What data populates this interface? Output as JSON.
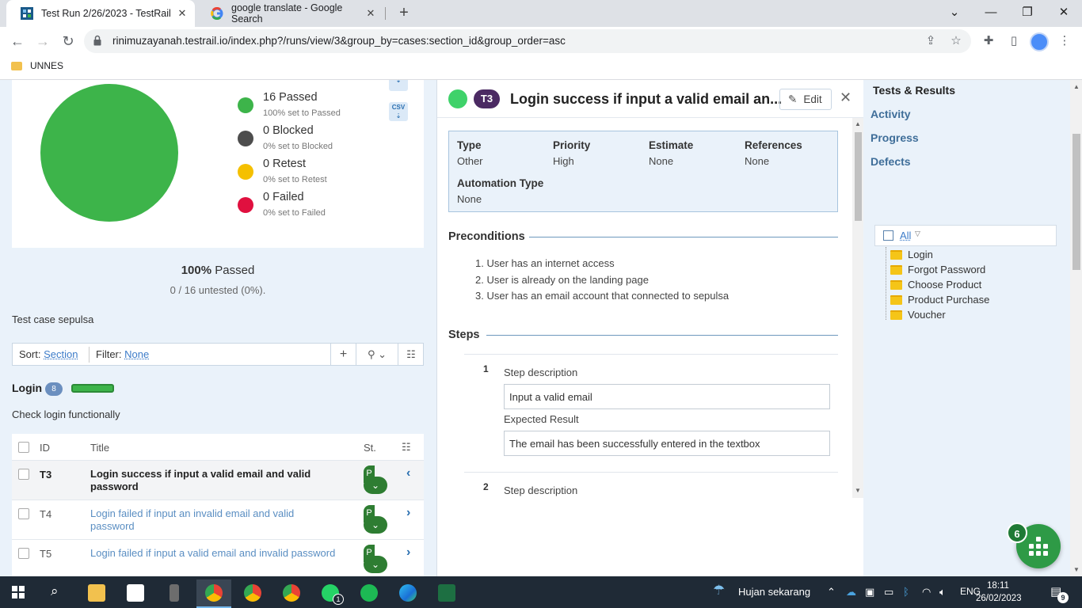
{
  "browser": {
    "tabs": [
      {
        "title": "Test Run 2/26/2023 - TestRail",
        "icon": "testrail-favicon",
        "active": true
      },
      {
        "title": "google translate - Google Search",
        "icon": "google-favicon",
        "active": false
      }
    ],
    "url": "rinimuzayanah.testrail.io/index.php?/runs/view/3&group_by=cases:section_id&group_order=asc",
    "bookmark": "UNNES"
  },
  "summary": {
    "legend": [
      {
        "label": "16 Passed",
        "sub": "100% set to Passed",
        "color": "#3db44a"
      },
      {
        "label": "0 Blocked",
        "sub": "0% set to Blocked",
        "color": "#4d4d4d"
      },
      {
        "label": "0 Retest",
        "sub": "0% set to Retest",
        "color": "#f5c000"
      },
      {
        "label": "0 Failed",
        "sub": "0% set to Failed",
        "color": "#e0103f"
      }
    ],
    "export_csv": "CSV",
    "percent": "100%",
    "percent_label": "Passed",
    "untested": "0 / 16 untested (0%).",
    "suite_description": "Test case sepulsa"
  },
  "sortbar": {
    "sort_label": "Sort:",
    "sort_value": "Section",
    "filter_label": "Filter:",
    "filter_value": "None"
  },
  "section": {
    "title": "Login",
    "count": "8",
    "progress": 1.0,
    "description": "Check login functionally"
  },
  "table": {
    "headers": {
      "id": "ID",
      "title": "Title",
      "status": "St."
    },
    "rows": [
      {
        "id": "T3",
        "title": "Login success if input a valid email and valid password",
        "status": "P",
        "selected": true
      },
      {
        "id": "T4",
        "title": "Login failed if input an invalid email and valid password",
        "status": "P",
        "selected": false
      },
      {
        "id": "T5",
        "title": "Login failed if input a valid email and invalid password",
        "status": "P",
        "selected": false
      }
    ]
  },
  "detail": {
    "badge": "T3",
    "title": "Login success if input a valid email an...",
    "edit_label": "Edit",
    "attributes": [
      {
        "key": "Type",
        "value": "Other"
      },
      {
        "key": "Priority",
        "value": "High"
      },
      {
        "key": "Estimate",
        "value": "None"
      },
      {
        "key": "References",
        "value": "None"
      },
      {
        "key": "Automation Type",
        "value": "None"
      }
    ],
    "preconditions_heading": "Preconditions",
    "preconditions": [
      "1. User has an internet access",
      "2. User is already on the landing page",
      "3. User has an email account that connected to sepulsa"
    ],
    "steps_heading": "Steps",
    "steps": [
      {
        "num": "1",
        "desc_label": "Step description",
        "desc": "Input a valid email",
        "expected_label": "Expected Result",
        "expected": "The email has been successfully entered in the textbox"
      },
      {
        "num": "2",
        "desc_label": "Step description"
      }
    ]
  },
  "sidebar": {
    "nav": [
      "Tests & Results",
      "Activity",
      "Progress",
      "Defects"
    ],
    "filter_all": "All",
    "sections": [
      "Login",
      "Forgot Password",
      "Choose Product",
      "Product Purchase",
      "Voucher"
    ],
    "fab_badge": "6"
  },
  "taskbar": {
    "weather": "Hujan sekarang",
    "lang": "ENG",
    "time": "18:11",
    "date": "26/02/2023",
    "notif_count": "9",
    "whatsapp_badge": "1"
  }
}
